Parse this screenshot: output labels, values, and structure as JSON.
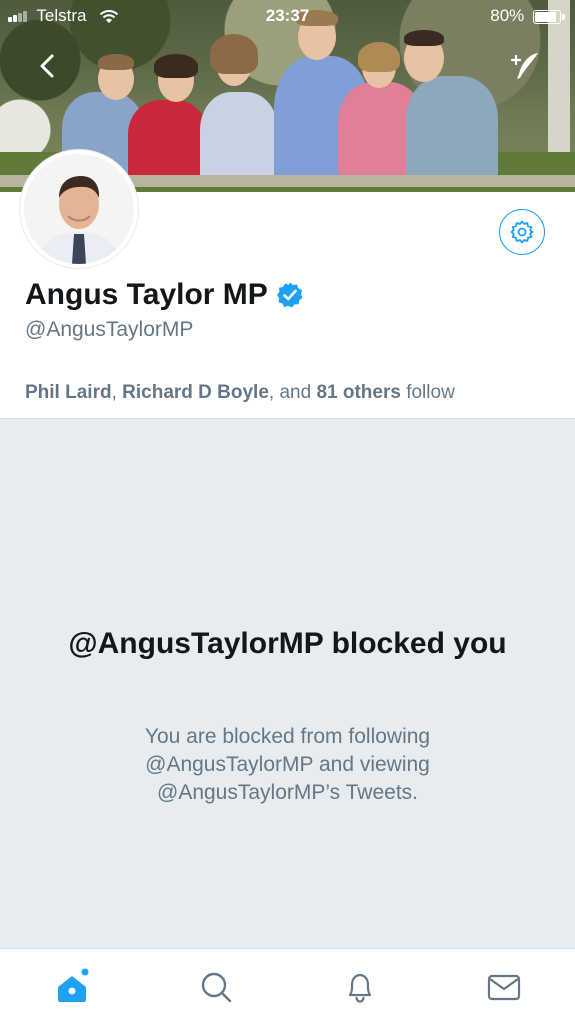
{
  "status_bar": {
    "carrier": "Telstra",
    "time": "23:37",
    "battery": "80%"
  },
  "profile": {
    "name": "Angus Taylor MP",
    "handle": "@AngusTaylorMP",
    "verified": true,
    "followed_by": {
      "user1": "Phil Laird",
      "sep1": ", ",
      "user2": "Richard D Boyle",
      "sep2": ", and ",
      "others": "81 others",
      "suffix": " follow"
    }
  },
  "blocked": {
    "title": "@AngusTaylorMP blocked you",
    "description": "You are blocked from following @AngusTaylorMP and viewing @AngusTaylorMP’s Tweets."
  },
  "icons": {
    "back": "chevron-left-icon",
    "compose": "feather-compose-icon",
    "settings": "gear-icon",
    "verified": "verified-badge-icon",
    "tabs": [
      "home-icon",
      "search-icon",
      "bell-icon",
      "mail-icon"
    ]
  },
  "colors": {
    "accent": "#1da1f2",
    "panel": "#e6ecf0",
    "secondary_text": "#657786",
    "primary_text": "#14171a"
  },
  "tabbar": {
    "active_tab": "home",
    "home_has_notification_dot": true
  }
}
